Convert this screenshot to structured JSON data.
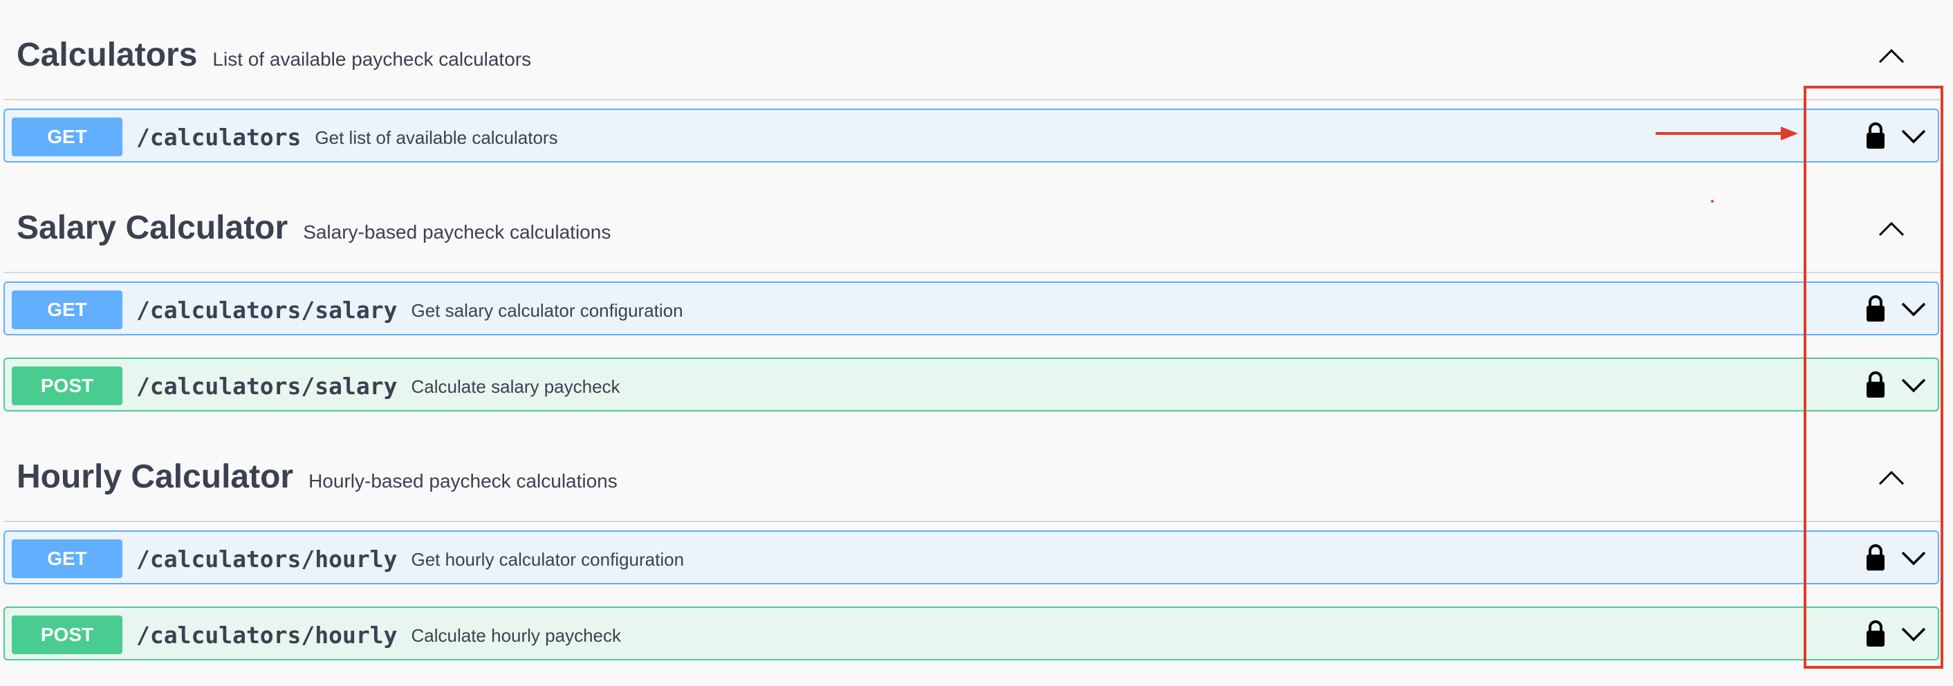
{
  "sections": [
    {
      "title": "Calculators",
      "description": "List of available paycheck calculators",
      "operations": [
        {
          "method": "GET",
          "path": "/calculators",
          "summary": "Get list of available calculators"
        }
      ]
    },
    {
      "title": "Salary Calculator",
      "description": "Salary-based paycheck calculations",
      "operations": [
        {
          "method": "GET",
          "path": "/calculators/salary",
          "summary": "Get salary calculator configuration"
        },
        {
          "method": "POST",
          "path": "/calculators/salary",
          "summary": "Calculate salary paycheck"
        }
      ]
    },
    {
      "title": "Hourly Calculator",
      "description": "Hourly-based paycheck calculations",
      "operations": [
        {
          "method": "GET",
          "path": "/calculators/hourly",
          "summary": "Get hourly calculator configuration"
        },
        {
          "method": "POST",
          "path": "/calculators/hourly",
          "summary": "Calculate hourly paycheck"
        }
      ]
    }
  ],
  "icons": {
    "collapse": "chevron-up-icon",
    "expand": "chevron-down-icon",
    "auth": "lock-icon"
  },
  "colors": {
    "get": "#61affe",
    "post": "#49cc90",
    "annotation": "#e03c2a"
  }
}
